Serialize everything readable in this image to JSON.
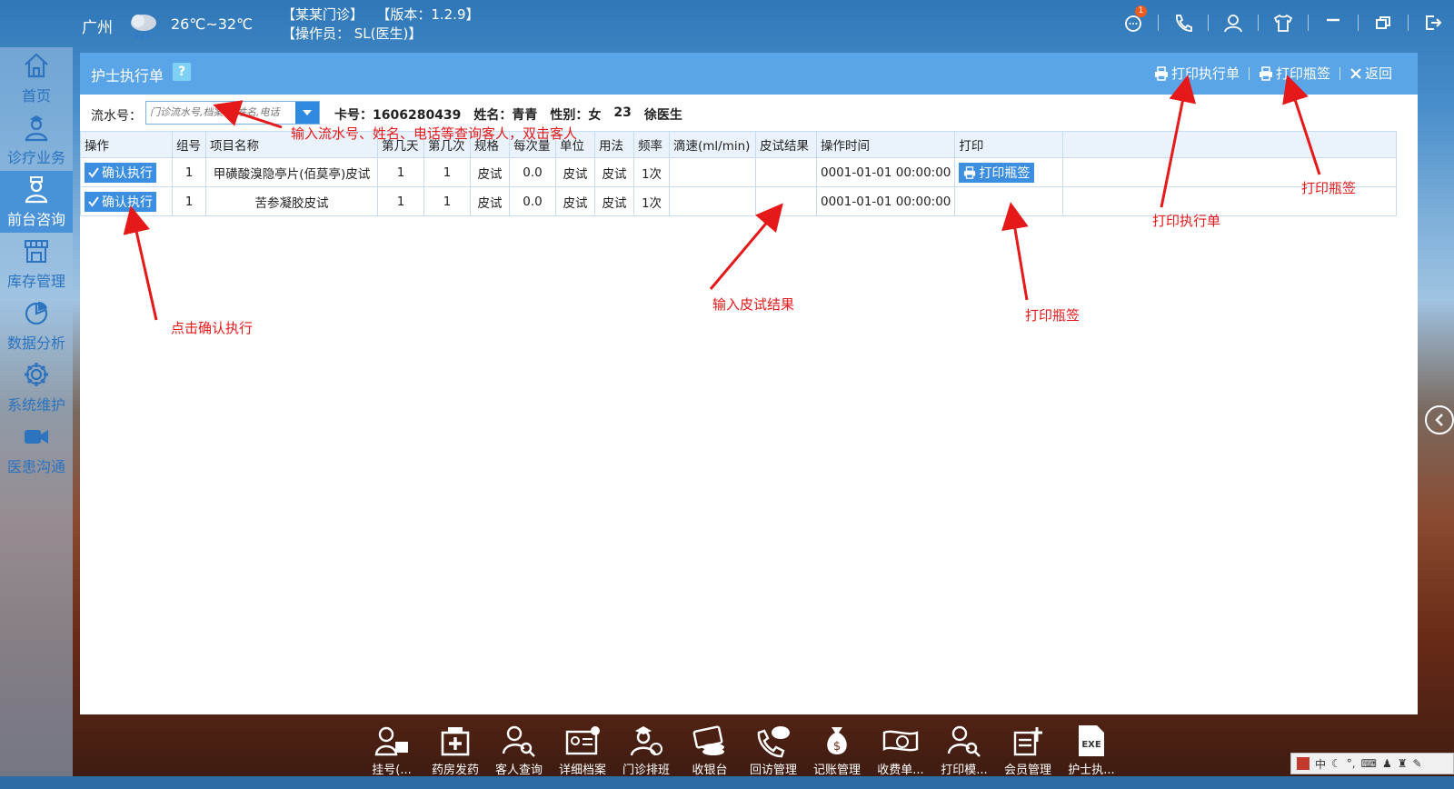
{
  "topbar": {
    "city": "广州",
    "weather_icon": "cloud-rain-icon",
    "temperature": "26℃~32℃",
    "clinic": "【某某门诊】",
    "version": "【版本：1.2.9】",
    "operator": "【操作员： SL(医生)】",
    "message_badge": "1"
  },
  "sidebar": {
    "items": [
      {
        "label": "首页",
        "icon": "home-icon"
      },
      {
        "label": "诊疗业务",
        "icon": "doctor-icon"
      },
      {
        "label": "前台咨询",
        "icon": "receptionist-icon"
      },
      {
        "label": "库存管理",
        "icon": "store-icon"
      },
      {
        "label": "数据分析",
        "icon": "pie-chart-icon"
      },
      {
        "label": "系统维护",
        "icon": "gear-icon"
      },
      {
        "label": "医患沟通",
        "icon": "video-icon"
      }
    ]
  },
  "panel": {
    "title": "护士执行单",
    "help": "?",
    "actions": {
      "print_sheet": "打印执行单",
      "print_label": "打印瓶签",
      "back": "返回"
    }
  },
  "search": {
    "label": "流水号：",
    "placeholder": "门诊流水号,档案号,姓名,电话",
    "card": "卡号：1606280439",
    "name": "姓名：青青",
    "gender": "性别：女",
    "age": "23",
    "doctor": "徐医生"
  },
  "table": {
    "headers": [
      "操作",
      "组号",
      "项目名称",
      "第几天",
      "第几次",
      "规格",
      "每次量",
      "单位",
      "用法",
      "频率",
      "滴速(ml/min)",
      "皮试结果",
      "操作时间",
      "打印",
      ""
    ],
    "exec_label": "确认执行",
    "print_label": "打印瓶签",
    "rows": [
      {
        "group": "1",
        "name": "甲磺酸溴隐亭片(佰莫亭)皮试",
        "day": "1",
        "times": "1",
        "spec": "皮试",
        "dose": "0.0",
        "unit": "皮试",
        "usage": "皮试",
        "freq": "1次",
        "drip": "",
        "result": "",
        "time": "0001-01-01 00:00:00",
        "print": true
      },
      {
        "group": "1",
        "name": "苦参凝胶皮试",
        "day": "1",
        "times": "1",
        "spec": "皮试",
        "dose": "0.0",
        "unit": "皮试",
        "usage": "皮试",
        "freq": "1次",
        "drip": "",
        "result": "",
        "time": "0001-01-01 00:00:00",
        "print": false
      }
    ]
  },
  "annotations": {
    "search_hint": "输入流水号、姓名、电话等查询客人，双击客人",
    "confirm_hint": "点击确认执行",
    "result_hint": "输入皮试结果",
    "print_label_hint": "打印瓶签",
    "print_sheet_hint": "打印执行单",
    "print_label_top_hint": "打印瓶签"
  },
  "dock": {
    "items": [
      {
        "label": "挂号(...",
        "icon": "register-icon"
      },
      {
        "label": "药房发药",
        "icon": "pharmacy-icon"
      },
      {
        "label": "客人查询",
        "icon": "search-user-icon"
      },
      {
        "label": "详细档案",
        "icon": "profile-card-icon"
      },
      {
        "label": "门诊排班",
        "icon": "schedule-icon"
      },
      {
        "label": "收银台",
        "icon": "cashier-icon"
      },
      {
        "label": "回访管理",
        "icon": "phone-chat-icon"
      },
      {
        "label": "记账管理",
        "icon": "money-bag-icon"
      },
      {
        "label": "收费单...",
        "icon": "bill-icon"
      },
      {
        "label": "打印模...",
        "icon": "print-template-icon"
      },
      {
        "label": "会员管理",
        "icon": "member-icon"
      },
      {
        "label": "护士执...",
        "icon": "exe-icon"
      }
    ]
  },
  "tray": {
    "ime": "中"
  },
  "colors": {
    "accent": "#5aa5e8",
    "button": "#3b8ee0",
    "annotation": "#e51919"
  }
}
